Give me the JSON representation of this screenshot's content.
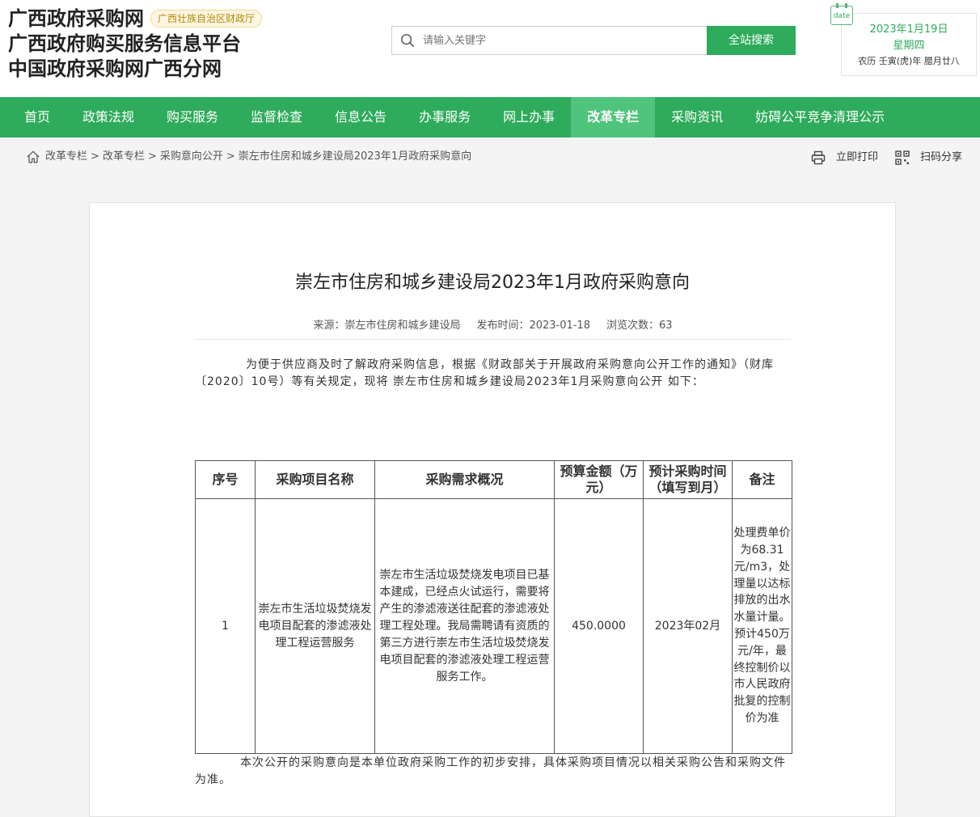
{
  "header": {
    "site_title_1": "广西政府采购网",
    "dept_badge": "广西壮族自治区财政厅",
    "site_title_2": "广西政府购买服务信息平台",
    "site_title_3": "中国政府采购网广西分网",
    "search": {
      "placeholder": "请输入关键字",
      "button_label": "全站搜索",
      "icon": "search-icon"
    },
    "date": {
      "tag": "date",
      "gregorian": "2023年1月19日",
      "weekday": "星期四",
      "lunar": "农历 壬寅(虎)年 腊月廿八"
    }
  },
  "nav": {
    "items": [
      {
        "label": "首页"
      },
      {
        "label": "政策法规"
      },
      {
        "label": "购买服务"
      },
      {
        "label": "监督检查"
      },
      {
        "label": "信息公告"
      },
      {
        "label": "办事服务"
      },
      {
        "label": "网上办事"
      },
      {
        "label": "改革专栏",
        "active": true
      },
      {
        "label": "采购资讯"
      },
      {
        "label": "妨碍公平竞争清理公示"
      }
    ]
  },
  "breadcrumb": {
    "items": [
      "改革专栏",
      "改革专栏",
      "采购意向公开",
      "崇左市住房和城乡建设局2023年1月政府采购意向"
    ],
    "separator": ">",
    "print_label": "立即打印",
    "share_label": "扫码分享"
  },
  "article": {
    "title": "崇左市住房和城乡建设局2023年1月政府采购意向",
    "meta": {
      "source": "来源：崇左市住房和城乡建设局",
      "publish_time": "发布时间：2023-01-18",
      "views": "浏览次数：63"
    },
    "intro": "为便于供应商及时了解政府采购信息，根据《财政部关于开展政府采购意向公开工作的通知》（财库〔2020〕10号）等有关规定，现将 崇左市住房和城乡建设局2023年1月采购意向公开 如下：",
    "table": {
      "headers": [
        "序号",
        "采购项目名称",
        "采购需求概况",
        "预算金额（万元）",
        "预计采购时间（填写到月）",
        "备注"
      ],
      "rows": [
        {
          "seq": "1",
          "name": "崇左市生活垃圾焚烧发电项目配套的渗滤液处理工程运营服务",
          "summary": "崇左市生活垃圾焚烧发电项目已基本建成，已经点火试运行，需要将产生的渗滤液送往配套的渗滤液处理工程处理。我局需聘请有资质的第三方进行崇左市生活垃圾焚烧发电项目配套的渗滤液处理工程运营服务工作。",
          "budget": "450.0000",
          "time": "2023年02月",
          "remark": "处理费单价为68.31元/m3，处理量以达标排放的出水水量计量。预计450万元/年，最终控制价以市人民政府批复的控制价为准"
        }
      ]
    },
    "closing": "本次公开的采购意向是本单位政府采购工作的初步安排，具体采购项目情况以相关采购公告和采购文件为准。"
  }
}
